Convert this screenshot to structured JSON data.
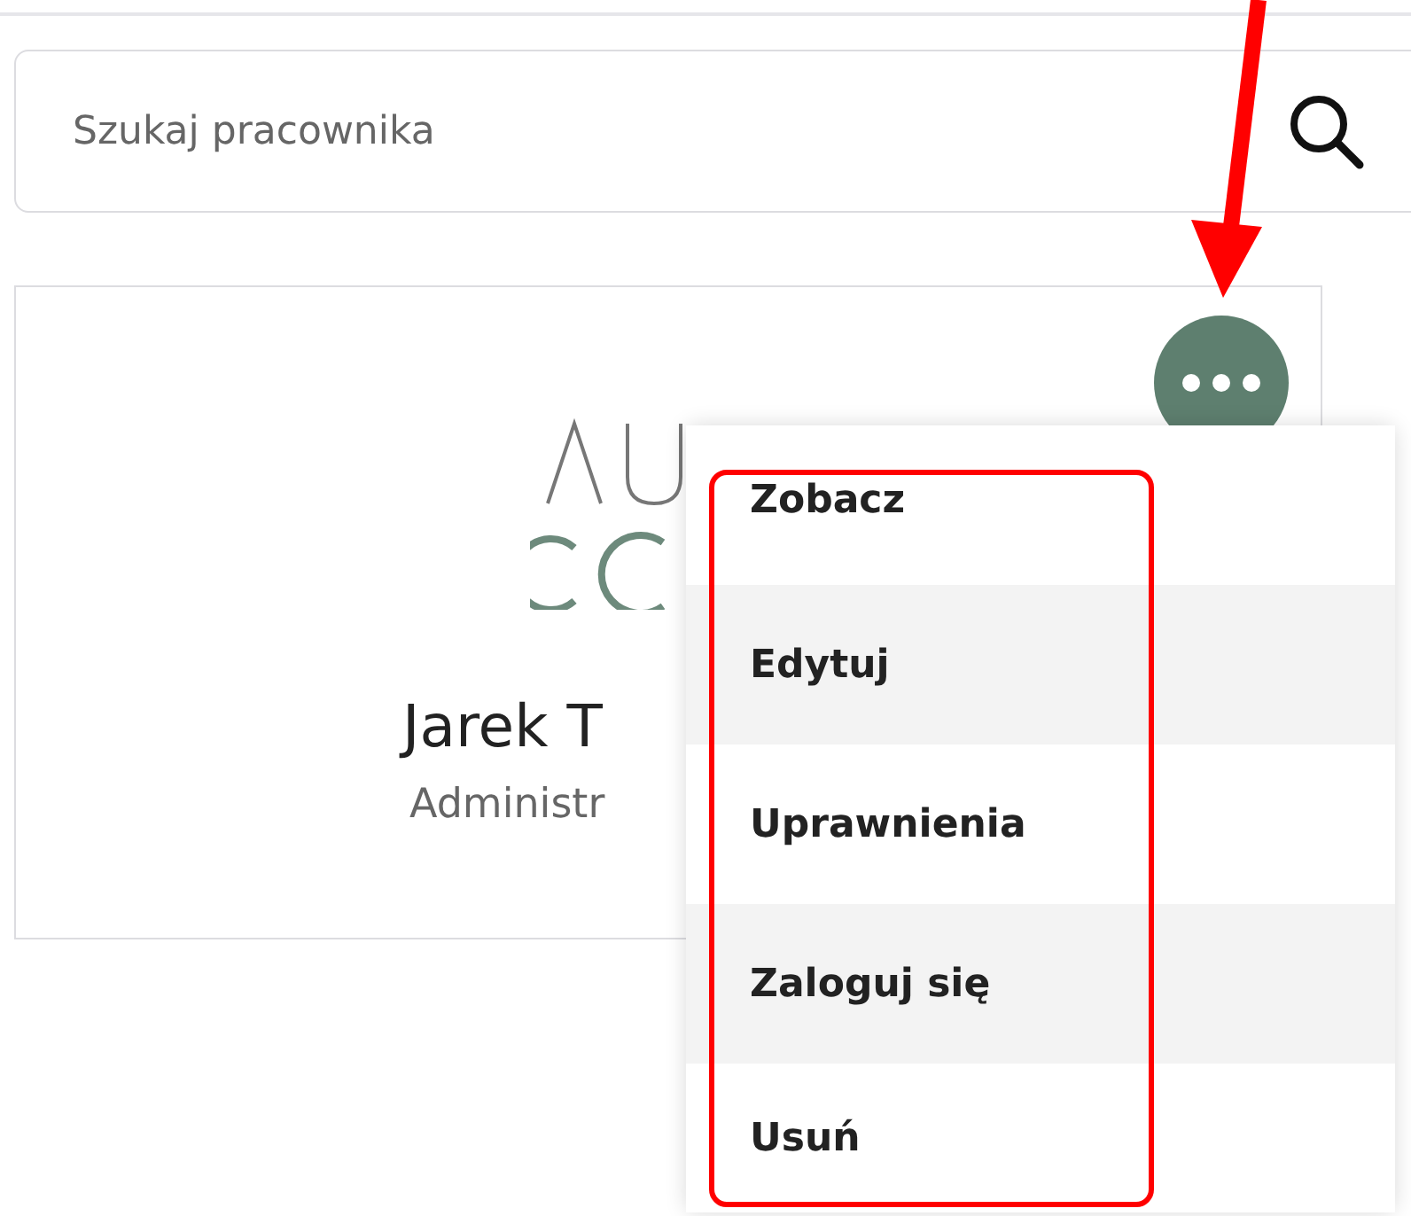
{
  "search": {
    "placeholder": "Szukaj pracownika"
  },
  "employee": {
    "name": "Jarek T",
    "role": "Administr"
  },
  "menu": {
    "items": [
      {
        "label": "Zobacz"
      },
      {
        "label": "Edytuj"
      },
      {
        "label": "Uprawnienia"
      },
      {
        "label": "Zaloguj się"
      },
      {
        "label": "Usuń"
      }
    ]
  },
  "annotations": {
    "arrow": true,
    "frame": true
  }
}
